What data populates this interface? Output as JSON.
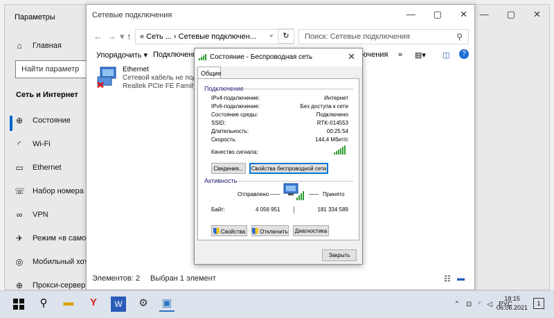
{
  "settings": {
    "title": "Параметры",
    "home": "Главная",
    "search_placeholder": "Найти параметр",
    "section": "Сеть и Интернет",
    "nav": [
      {
        "label": "Состояние",
        "icon": "globe-icon"
      },
      {
        "label": "Wi-Fi",
        "icon": "wifi-icon"
      },
      {
        "label": "Ethernet",
        "icon": "ethernet-icon"
      },
      {
        "label": "Набор номера",
        "icon": "dialup-icon"
      },
      {
        "label": "VPN",
        "icon": "vpn-icon"
      },
      {
        "label": "Режим «в самолете»",
        "icon": "airplane-icon"
      },
      {
        "label": "Мобильный хот-спот",
        "icon": "hotspot-icon"
      },
      {
        "label": "Прокси-сервер",
        "icon": "proxy-globe-icon"
      }
    ]
  },
  "explorer": {
    "title": "Сетевые подключения",
    "address": "« Сеть ... › Сетевые подключен...",
    "search_placeholder": "Поиск: Сетевые подключения",
    "cmd": {
      "organize": "Упорядочить ▾",
      "connect": "Подключение к",
      "connections": "ключения",
      "more": "»"
    },
    "ethernet": {
      "name": "Ethernet",
      "status": "Сетевой кабель не подключен",
      "device": "Realtek PCIe FE Family Controller"
    },
    "statusbar": {
      "items": "Элементов: 2",
      "selected": "Выбран 1 элемент"
    }
  },
  "dialog": {
    "title": "Состояние - Беспроводная сеть",
    "tab": "Общие",
    "connection_group": "Подключение",
    "rows": [
      {
        "label": "IPv4-подключение:",
        "value": "Интернет"
      },
      {
        "label": "IPv6-подключение:",
        "value": "Без доступа к сети"
      },
      {
        "label": "Состояние среды:",
        "value": "Подключено"
      },
      {
        "label": "SSID:",
        "value": "RTK-014553"
      },
      {
        "label": "Длительность:",
        "value": "00:25:54"
      },
      {
        "label": "Скорость:",
        "value": "144,4 Мбит/с"
      }
    ],
    "signal_label": "Качество сигнала:",
    "details_btn": "Сведения...",
    "wireless_props_btn": "Свойства беспроводной сети",
    "activity_group": "Активность",
    "sent_label": "Отправлено",
    "received_label": "Принято",
    "bytes_label": "Байт:",
    "bytes_sent": "4 056 951",
    "bytes_received": "181 334 589",
    "props_btn": "Свойства",
    "disable_btn": "Отключить",
    "diagnose_btn": "Диагностика",
    "close_btn": "Закрыть"
  },
  "taskbar": {
    "lang": "РУС",
    "time": "18:15",
    "date": "06.06.2021",
    "notification_count": "1"
  },
  "colors": {
    "accent": "#0078d7",
    "signal": "#2e9b2e"
  }
}
